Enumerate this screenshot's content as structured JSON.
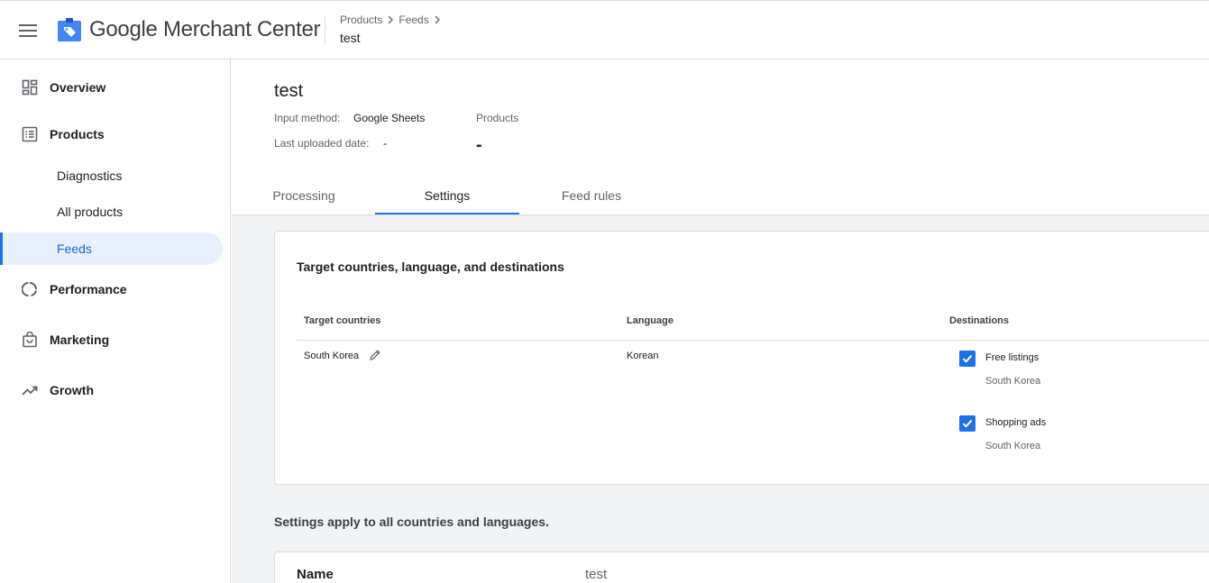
{
  "header": {
    "app_name": "Google Merchant Center",
    "breadcrumb": [
      "Products",
      "Feeds"
    ],
    "current": "test",
    "logo_color": "#4285f4"
  },
  "sidebar": {
    "items": [
      {
        "label": "Overview",
        "icon": "dashboard-icon"
      },
      {
        "label": "Products",
        "icon": "list-icon"
      },
      {
        "label": "Diagnostics"
      },
      {
        "label": "All products"
      },
      {
        "label": "Feeds",
        "active": true
      },
      {
        "label": "Performance",
        "icon": "donut-icon"
      },
      {
        "label": "Marketing",
        "icon": "shopping-bag-icon"
      },
      {
        "label": "Growth",
        "icon": "trending-up-icon"
      }
    ]
  },
  "feed": {
    "title": "test",
    "input_method_label": "Input method:",
    "input_method_value": "Google Sheets",
    "last_uploaded_label": "Last uploaded date:",
    "last_uploaded_value": "-",
    "products_label": "Products",
    "products_value": "-"
  },
  "tabs": [
    {
      "label": "Processing"
    },
    {
      "label": "Settings",
      "active": true
    },
    {
      "label": "Feed rules"
    }
  ],
  "targets_card": {
    "title": "Target countries, language, and destinations",
    "columns": [
      "Target countries",
      "Language",
      "Destinations"
    ],
    "row": {
      "country": "South Korea",
      "language": "Korean",
      "destinations": [
        {
          "label": "Free listings",
          "sub": "South Korea",
          "checked": true
        },
        {
          "label": "Shopping ads",
          "sub": "South Korea",
          "checked": true
        }
      ]
    }
  },
  "apply_note": "Settings apply to all countries and languages.",
  "name_row": {
    "label": "Name",
    "value": "test"
  },
  "colors": {
    "accent": "#1a73e8",
    "active_bg": "#e8f0fe",
    "page_bg": "#f1f3f4"
  }
}
